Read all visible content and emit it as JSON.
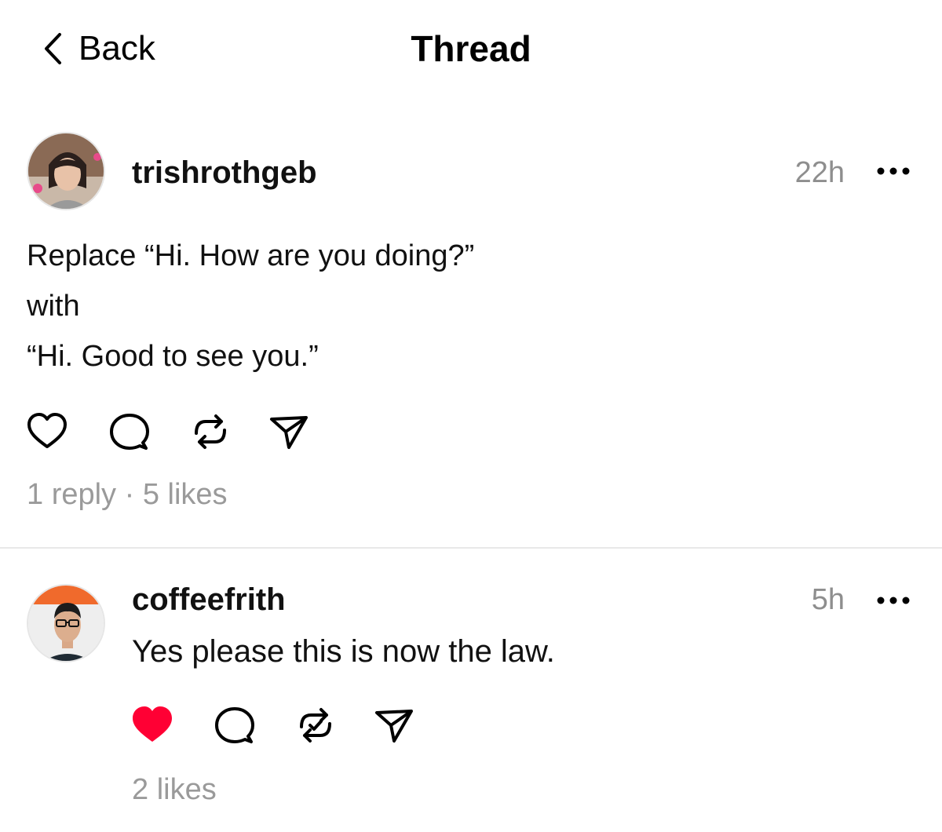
{
  "nav": {
    "back_label": "Back",
    "title": "Thread"
  },
  "post": {
    "username": "trishrothgeb",
    "time": "22h",
    "text_lines": [
      "Replace “Hi. How are you doing?”",
      "with",
      "“Hi. Good to see you.”"
    ],
    "stats": "1 reply · 5 likes",
    "liked": false,
    "icons": [
      "heart-icon",
      "comment-icon",
      "repost-icon",
      "send-icon",
      "more-icon"
    ]
  },
  "reply": {
    "username": "coffeefrith",
    "time": "5h",
    "text": "Yes please this is now the law.",
    "stats": "2 likes",
    "liked": true,
    "icons": [
      "heart-filled-icon",
      "comment-icon",
      "repost-check-icon",
      "send-icon",
      "more-icon"
    ]
  },
  "colors": {
    "like_red": "#ff0034",
    "muted_gray": "#9a9a9a",
    "text": "#111111"
  }
}
